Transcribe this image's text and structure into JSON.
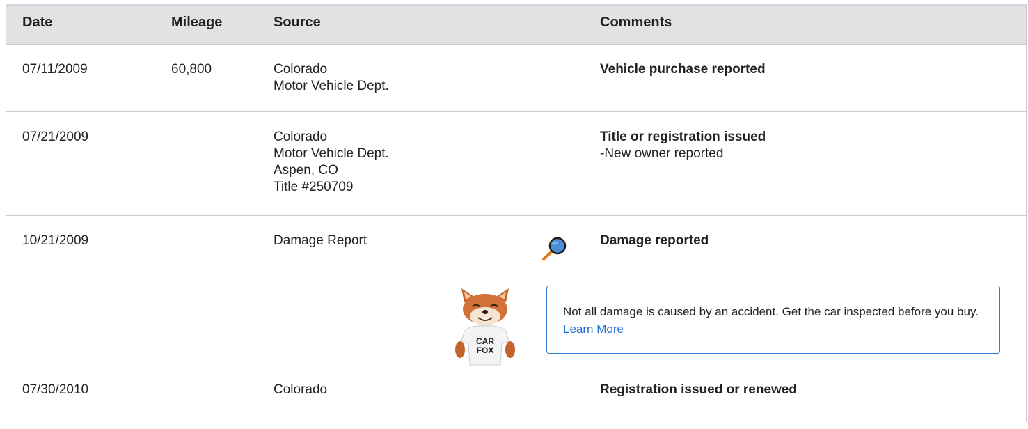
{
  "table": {
    "headers": {
      "date": "Date",
      "mileage": "Mileage",
      "source": "Source",
      "comments": "Comments"
    },
    "rows": [
      {
        "date": "07/11/2009",
        "mileage": "60,800",
        "source": [
          "Colorado",
          "Motor Vehicle Dept."
        ],
        "comment_title": "Vehicle purchase reported",
        "comment_sub": ""
      },
      {
        "date": "07/21/2009",
        "mileage": "",
        "source": [
          "Colorado",
          "Motor Vehicle Dept.",
          "Aspen, CO",
          "Title #250709"
        ],
        "comment_title": "Title or registration issued",
        "comment_sub": "-New owner reported"
      },
      {
        "date": "10/21/2009",
        "mileage": "",
        "source": [
          "Damage Report"
        ],
        "comment_title": "Damage reported",
        "comment_sub": "",
        "icon": "magnifier-icon",
        "callout": {
          "text": "Not all damage is caused by an accident. Get the car inspected before you buy.",
          "link": "Learn More"
        },
        "mascot": {
          "name": "carfox-mascot",
          "shirt_line1": "CAR",
          "shirt_line2": "FOX"
        }
      },
      {
        "date": "07/30/2010",
        "mileage": "",
        "source": [
          "Colorado"
        ],
        "comment_title": "Registration issued or renewed",
        "comment_sub": ""
      }
    ]
  },
  "colors": {
    "header_bg": "#e2e2e2",
    "link": "#1f6fd1",
    "callout_border": "#2b7bd6",
    "magnifier_lens": "#4a8fd8",
    "magnifier_handle": "#e07a1a"
  }
}
